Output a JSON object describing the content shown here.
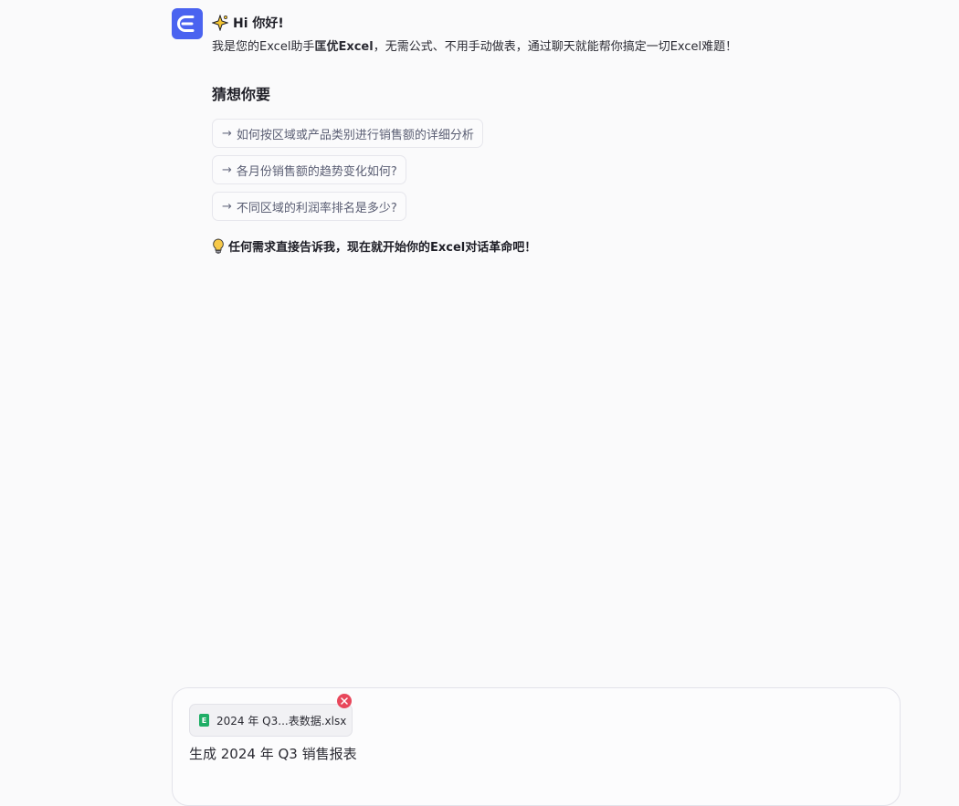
{
  "assistant": {
    "avatar_letter": "E",
    "accent_color": "#4a63f0",
    "greeting": "Hi 你好!",
    "intro_before": "我是您的Excel助手",
    "intro_brand": "匡优Excel",
    "intro_after": "，无需公式、不用手动做表，通过聊天就能帮你搞定一切Excel难题！",
    "suggest_title": "猜想你要",
    "suggestions": [
      {
        "label": "如何按区域或产品类别进行销售额的详细分析"
      },
      {
        "label": "各月份销售额的趋势变化如何?"
      },
      {
        "label": "不同区域的利润率排名是多少?"
      }
    ],
    "tip": "任何需求直接告诉我，现在就开始你的Excel对话革命吧！",
    "icons": {
      "greeting": "sparkle-icon",
      "tip": "lightbulb-icon",
      "arrow": "arrow-right-icon"
    }
  },
  "composer": {
    "attachment_name": "2024 年 Q3...表数据.xlsx",
    "attachment_icon_letter": "E",
    "input_value": "生成 2024 年 Q3 销售报表"
  }
}
